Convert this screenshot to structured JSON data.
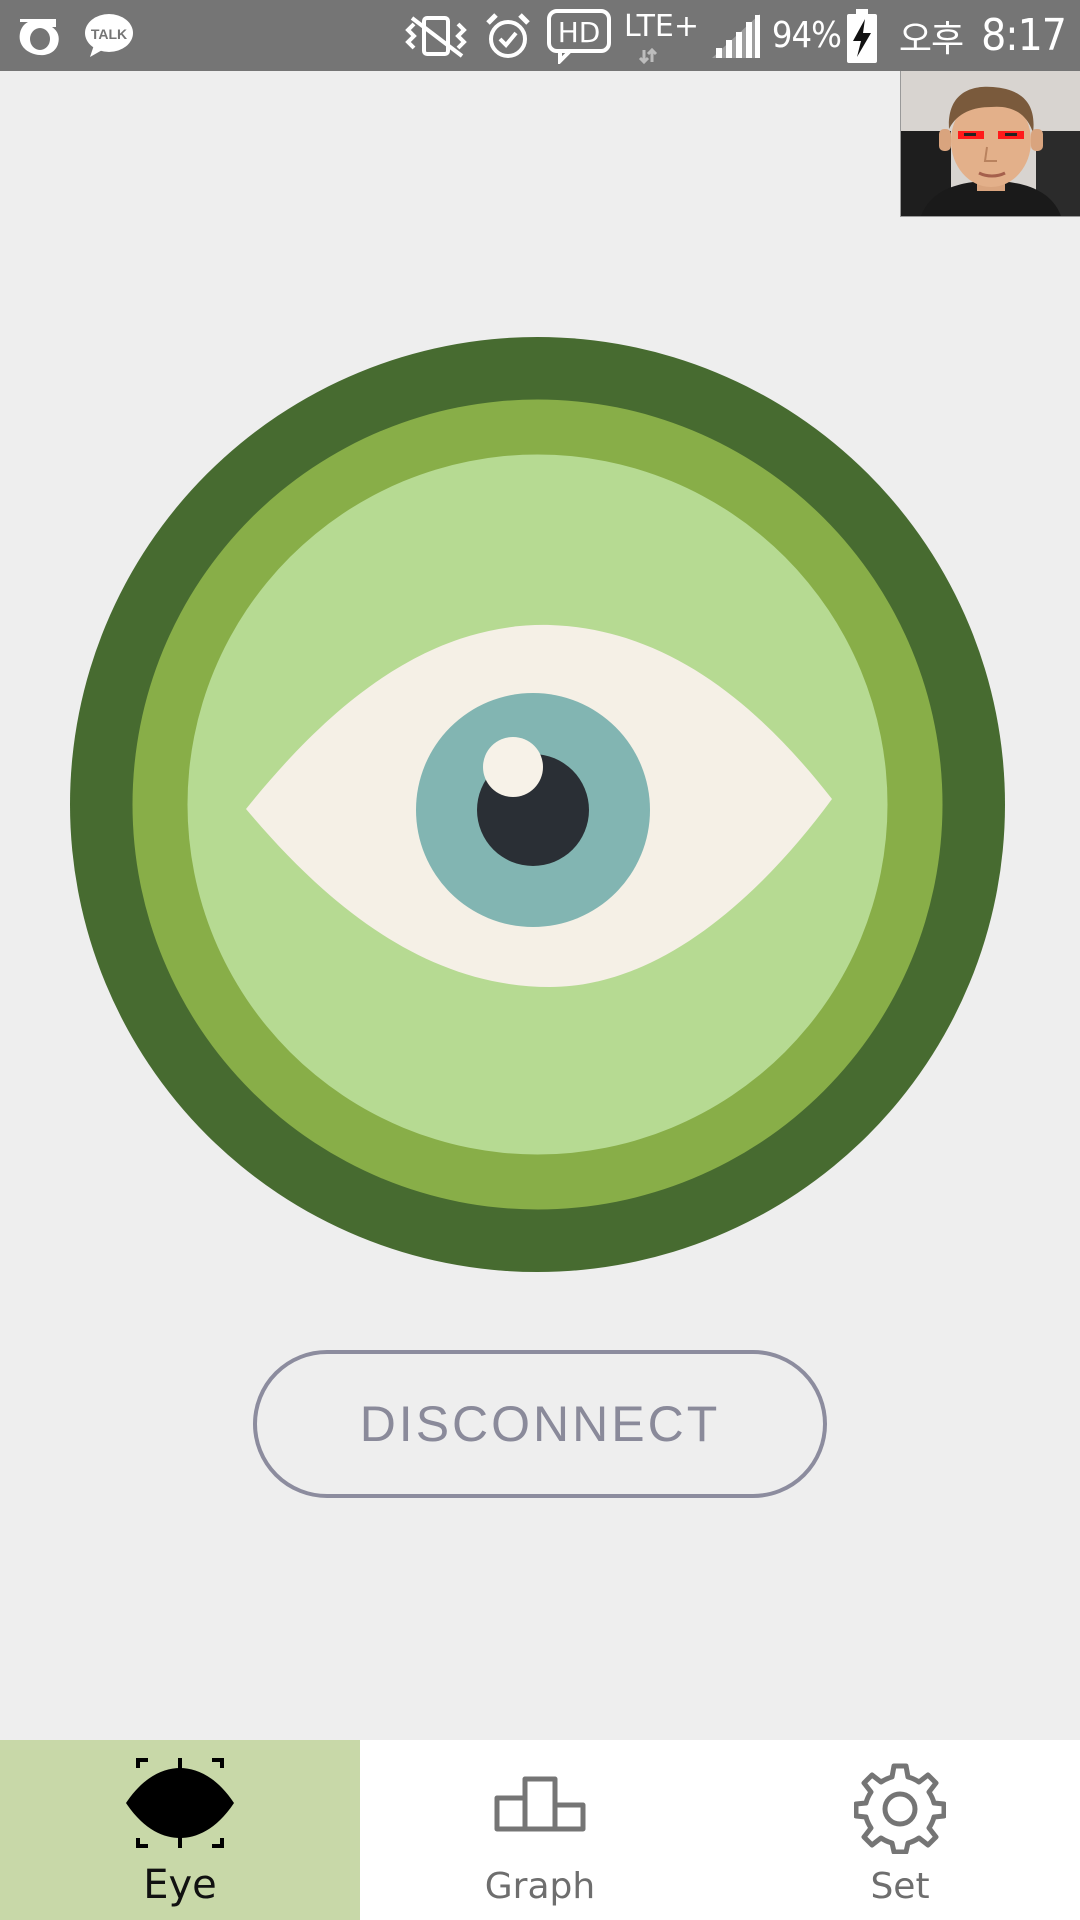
{
  "status_bar": {
    "left_icons": [
      "olleh-icon",
      "kakaotalk-icon"
    ],
    "talk_badge": "TALK",
    "right_icons": [
      "vibrate-icon",
      "alarm-icon",
      "hd-icon",
      "lte-icon",
      "signal-icon",
      "battery-charging-icon"
    ],
    "hd_label": "HD",
    "lte_label": "LTE+",
    "battery_percent": "94%",
    "ampm": "오후",
    "time": "8:17"
  },
  "camera_preview": {
    "icon": "camera-preview-face"
  },
  "eye_indicator": {
    "icon": "eye-icon",
    "colors": {
      "outer_ring": "#476b30",
      "middle_ring": "#88ae48",
      "inner_disc": "#b6da92",
      "sclera": "#f5f0e6",
      "iris": "#82b5b2",
      "pupil": "#2a2f35",
      "highlight": "#f7f2e8"
    }
  },
  "disconnect_button": {
    "label": "DISCONNECT"
  },
  "bottom_nav": {
    "active_color": "#c8d8a8",
    "tabs": [
      {
        "label": "Eye",
        "icon": "eye-scan-icon",
        "active": true
      },
      {
        "label": "Graph",
        "icon": "bar-graph-icon",
        "active": false
      },
      {
        "label": "Set",
        "icon": "gear-icon",
        "active": false
      }
    ]
  }
}
